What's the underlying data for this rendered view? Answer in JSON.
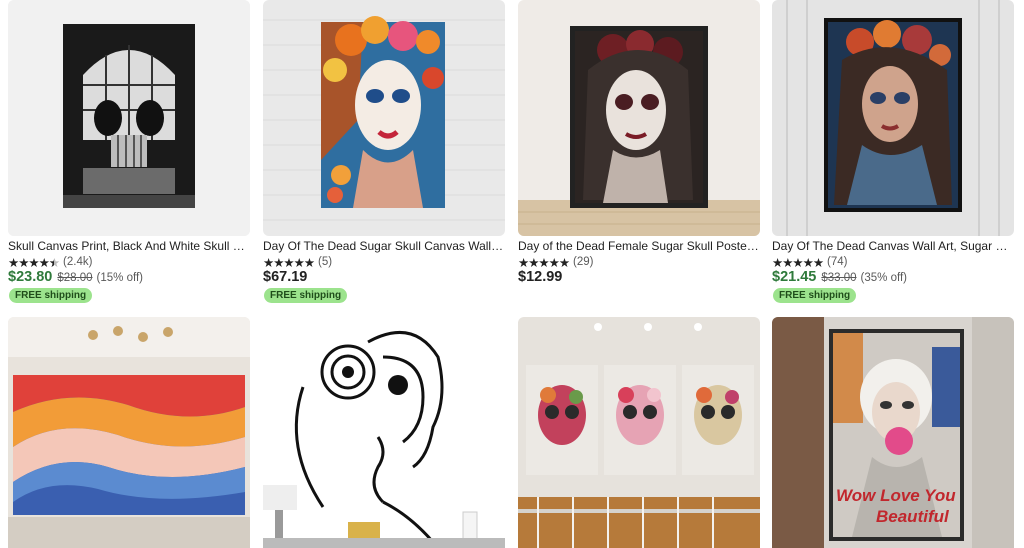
{
  "listings": [
    {
      "title": "Skull Canvas Print, Black And White Skull Canvas…",
      "rating_count": "(2.4k)",
      "price": "$23.80",
      "original_price": "$28.00",
      "discount": "(15% off)",
      "shipping": "FREE shipping",
      "stars": 4.5
    },
    {
      "title": "Day Of The Dead Sugar Skull Canvas Wall Art, Be…",
      "rating_count": "(5)",
      "price": "$67.19",
      "shipping": "FREE shipping",
      "stars": 5
    },
    {
      "title": "Day of the Dead Female Sugar Skull Poster: Goth…",
      "rating_count": "(29)",
      "price": "$12.99",
      "stars": 5
    },
    {
      "title": "Day Of The Dead Canvas Wall Art, Sugar Skull W…",
      "rating_count": "(74)",
      "price": "$21.45",
      "original_price": "$33.00",
      "discount": "(35% off)",
      "shipping": "FREE shipping",
      "stars": 5
    }
  ],
  "artwork_text": {
    "love_line1": "Wow Love You",
    "love_line2": "Beautiful"
  },
  "colors": {
    "sale_price": "#2f7a3b",
    "shipping_badge": "#9ce38d",
    "stars": "#222222"
  },
  "icons": {
    "star": "star-icon"
  }
}
